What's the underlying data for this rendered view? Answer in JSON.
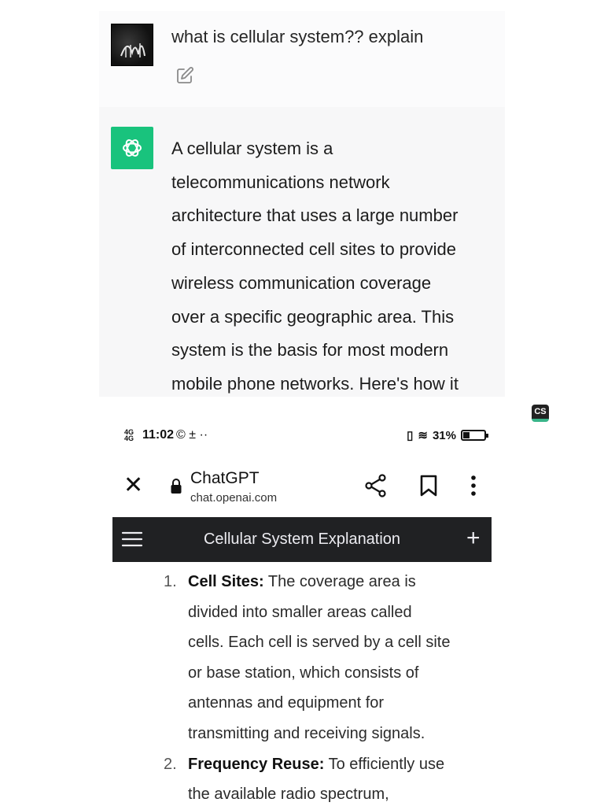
{
  "chat": {
    "user_message": "what is cellular system?? explain",
    "assistant_lines": [
      "A cellular system is a",
      "telecommunications network",
      "architecture that uses a large number",
      "of interconnected cell sites to provide",
      "wireless communication coverage",
      "over a specific geographic area. This",
      "system is the basis for most modern",
      "mobile phone networks. Here's how it"
    ]
  },
  "badge": {
    "label": "CS"
  },
  "status_bar": {
    "network": "4G 4G",
    "time": "11:02",
    "extra_icons": "© ± ··",
    "battery_percent": "31%",
    "battery_level": 0.31
  },
  "browser": {
    "close_label": "✕",
    "site_title": "ChatGPT",
    "site_url": "chat.openai.com"
  },
  "app_header": {
    "title": "Cellular System Explanation",
    "new_chat_label": "+"
  },
  "list": [
    {
      "number": "1.",
      "heading": "Cell Sites:",
      "lines": [
        " The coverage area is",
        "divided into smaller areas called",
        "cells. Each cell is served by a cell site",
        "or base station, which consists of",
        "antennas and equipment for",
        "transmitting and receiving signals."
      ]
    },
    {
      "number": "2.",
      "heading": "Frequency Reuse:",
      "lines": [
        " To efficiently use",
        "the available radio spectrum,"
      ]
    }
  ],
  "colors": {
    "gpt_green": "#19c37d",
    "header_bg": "#202123",
    "chat_bg": "#f7f7f8"
  }
}
